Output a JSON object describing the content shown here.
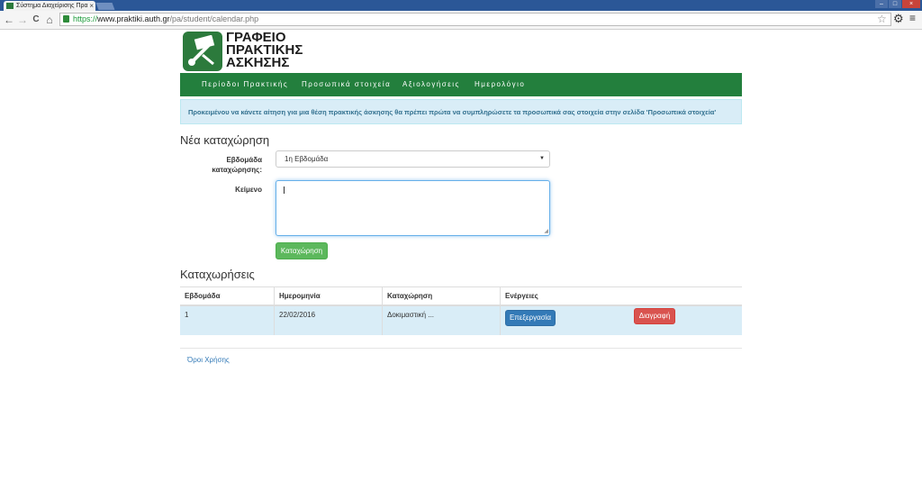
{
  "browser": {
    "tab_title": "Σύστημα Διαχείρισης Πρα",
    "tab_close": "×",
    "url_scheme": "https://",
    "url_host": "www.praktiki.auth.gr",
    "url_path": "/pa/student/calendar.php",
    "back": "←",
    "forward": "→",
    "reload": "C",
    "home": "⌂",
    "star": "☆",
    "gear": "⚙",
    "menu": "≡"
  },
  "logo": {
    "line1": "ΓΡΑΦΕΙΟ",
    "line2": "ΠΡΑΚΤΙΚΗΣ",
    "line3": "ΑΣΚΗΣΗΣ",
    "color": "#2c7a3c"
  },
  "nav": {
    "items": [
      {
        "label": "Περίοδοι Πρακτικής"
      },
      {
        "label": "Προσωπικά στοιχεία"
      },
      {
        "label": "Αξιολογήσεις"
      },
      {
        "label": "Ημερολόγιο"
      }
    ],
    "color": "#237f3d"
  },
  "alert": {
    "text": "Προκειμένου να κάνετε αίτηση για μια θέση πρακτικής άσκησης θα πρέπει πρώτα να συμπληρώσετε τα προσωπικά σας στοιχεία στην σελίδα 'Προσωπικά στοιχεία'"
  },
  "form": {
    "title": "Νέα καταχώρηση",
    "week_label_line1": "Εβδομάδα",
    "week_label_line2": "καταχώρησης:",
    "week_selected": "1η Εβδομάδα",
    "text_label": "Κείμενο",
    "text_value": "",
    "submit_label": "Καταχώρηση",
    "submit_color": "#5cb85c"
  },
  "entries": {
    "title": "Καταχωρήσεις",
    "columns": [
      "Εβδομάδα",
      "Ημερομηνία",
      "Καταχώρηση",
      "Ενέργειες"
    ],
    "rows": [
      {
        "week": "1",
        "date": "22/02/2016",
        "entry": "Δοκιμαστική ...",
        "edit_label": "Επεξεργασία",
        "delete_label": "Διαγραφή"
      }
    ]
  },
  "footer": {
    "terms_link": "Όροι Χρήσης"
  }
}
